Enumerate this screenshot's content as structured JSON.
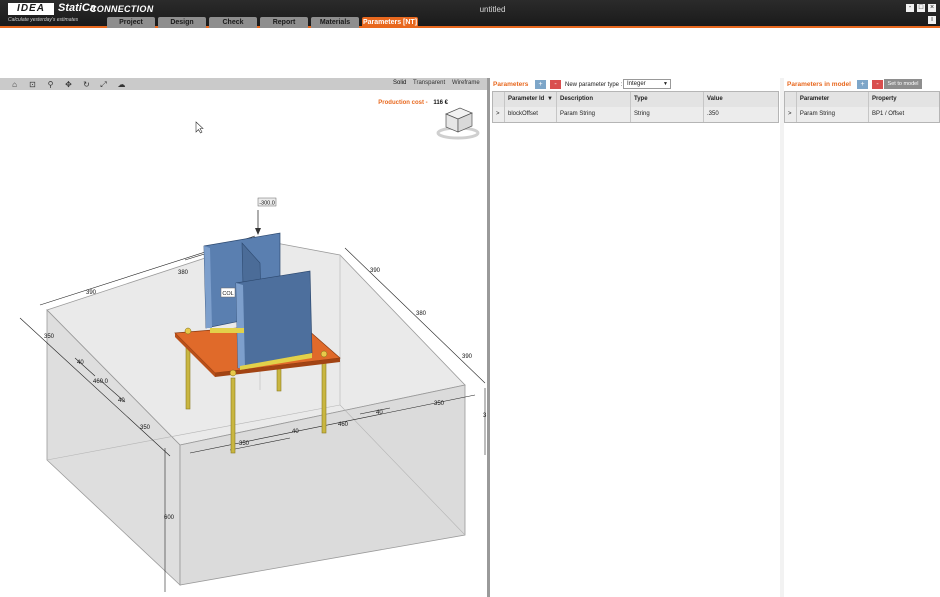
{
  "app": {
    "logo_text": "IDEA",
    "brand": "StatiCa",
    "product": "CONNECTION",
    "tagline": "Calculate yesterday's estimates",
    "window_title": "untitled",
    "accent_color": "#e8681e"
  },
  "tabs": [
    {
      "label": "Project"
    },
    {
      "label": "Design"
    },
    {
      "label": "Check"
    },
    {
      "label": "Report"
    },
    {
      "label": "Materials"
    },
    {
      "label": "Parameters [NT]",
      "active": true
    }
  ],
  "window_controls": {
    "minimize": "-",
    "maximize": "□",
    "close": "×",
    "info": "i"
  },
  "viewport": {
    "toolbar_icons": [
      "home-icon",
      "zoom-window-icon",
      "zoom-icon",
      "pan-icon",
      "rotate-icon",
      "zoom-extents-icon",
      "shape-icon"
    ],
    "view_modes": [
      "Solid",
      "Transparent",
      "Wireframe"
    ],
    "active_view_mode": "Solid",
    "production_cost_label": "Production cost",
    "production_cost_sep": "-",
    "production_cost_value": "116 €",
    "model_labels": {
      "load": "-300.0",
      "member": "COL",
      "dim_390_a": "390",
      "dim_380_a": "380",
      "dim_390_b": "390",
      "dim_380_b": "380",
      "dim_390_c": "390",
      "dim_350_a": "350",
      "dim_40_a": "40",
      "dim_460_a": "460.0",
      "dim_40_b": "40",
      "dim_350_b": "350",
      "dim_350_c": "350",
      "dim_40_c": "40",
      "dim_460_b": "460",
      "dim_40_d": "40",
      "dim_350_d": "350",
      "dim_600": "600",
      "dim_3": "3"
    }
  },
  "parameters_panel": {
    "title": "Parameters",
    "add": "+",
    "remove": "-",
    "new_type_label": "New parameter type :",
    "new_type_value": "Integer",
    "columns": [
      "Parameter Id",
      "Description",
      "Type",
      "Value"
    ],
    "rows": [
      {
        "expander": ">",
        "id": "blockOffset",
        "description": "Param String",
        "type": "String",
        "value": ".350"
      }
    ]
  },
  "model_panel": {
    "title": "Parameters in model",
    "add": "+",
    "remove": "-",
    "set_button": "Set to model",
    "columns": [
      "Parameter",
      "Property"
    ],
    "rows": [
      {
        "expander": ">",
        "parameter": "Param String",
        "property": "BP1 / Offset"
      }
    ]
  }
}
